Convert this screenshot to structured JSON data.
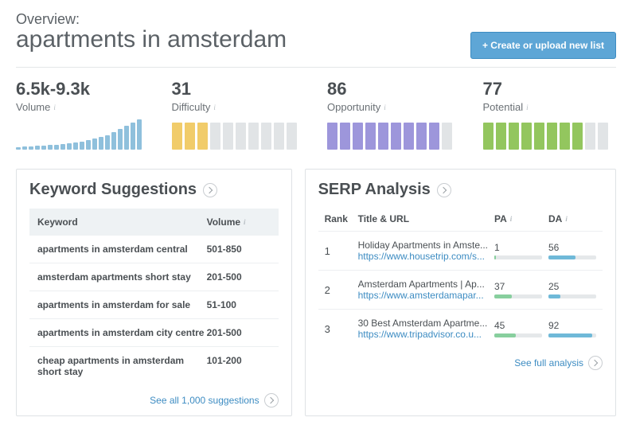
{
  "header": {
    "overview_label": "Overview:",
    "title": "apartments in amsterdam",
    "create_button": "+ Create or upload new list"
  },
  "metrics": {
    "volume": {
      "value": "6.5k-9.3k",
      "label": "Volume",
      "bars": [
        3,
        4,
        4,
        5,
        5,
        6,
        6,
        7,
        8,
        9,
        10,
        12,
        14,
        16,
        18,
        22,
        26,
        30,
        34,
        38
      ]
    },
    "difficulty": {
      "value": "31",
      "label": "Difficulty",
      "filled": 3,
      "total": 10,
      "color": "#f1cc6a",
      "off": "#e1e4e6"
    },
    "opportunity": {
      "value": "86",
      "label": "Opportunity",
      "filled": 9,
      "total": 10,
      "color": "#9d96db",
      "off": "#e1e4e6"
    },
    "potential": {
      "value": "77",
      "label": "Potential",
      "filled": 8,
      "total": 10,
      "color": "#93c65e",
      "off": "#e1e4e6"
    }
  },
  "keyword_suggestions": {
    "title": "Keyword Suggestions",
    "col_keyword": "Keyword",
    "col_volume": "Volume",
    "rows": [
      {
        "k": "apartments in amsterdam central",
        "v": "501-850"
      },
      {
        "k": "amsterdam apartments short stay",
        "v": "201-500"
      },
      {
        "k": "apartments in amsterdam for sale",
        "v": "51-100"
      },
      {
        "k": "apartments in amsterdam city centre",
        "v": "201-500"
      },
      {
        "k": "cheap apartments in amsterdam short stay",
        "v": "101-200"
      }
    ],
    "see_all": "See all 1,000 suggestions"
  },
  "serp_analysis": {
    "title": "SERP Analysis",
    "col_rank": "Rank",
    "col_title": "Title & URL",
    "col_pa": "PA",
    "col_da": "DA",
    "pa_color": "#88cf9e",
    "da_color": "#6fb9d8",
    "rows": [
      {
        "rank": "1",
        "title": "Holiday Apartments in Amste...",
        "url": "https://www.housetrip.com/s...",
        "pa": 1,
        "da": 56
      },
      {
        "rank": "2",
        "title": "Amsterdam Apartments | Ap...",
        "url": "https://www.amsterdamapar...",
        "pa": 37,
        "da": 25
      },
      {
        "rank": "3",
        "title": "30 Best Amsterdam Apartme...",
        "url": "https://www.tripadvisor.co.u...",
        "pa": 45,
        "da": 92
      }
    ],
    "see_full": "See full analysis"
  }
}
